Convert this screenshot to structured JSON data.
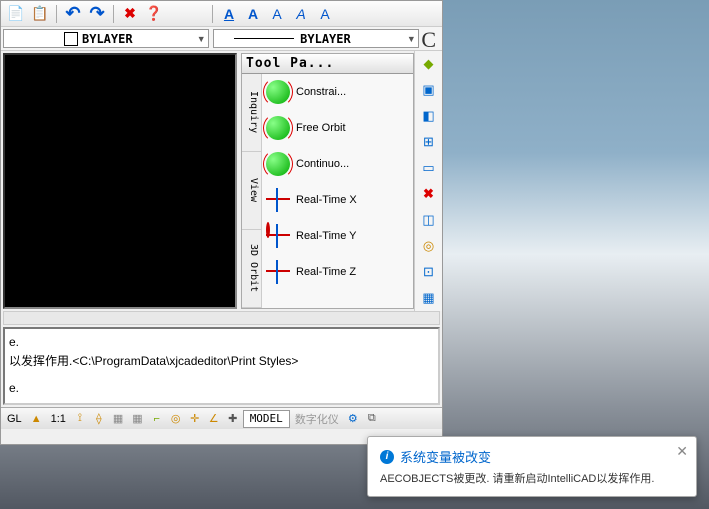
{
  "toolbar1": {
    "new": "📄",
    "copy": "📋",
    "undo": "↶",
    "redo": "↷",
    "delete": "✖",
    "help": "❓",
    "textA1": "A",
    "textA2": "A",
    "textA3": "A",
    "textA4": "A",
    "textA5": "A"
  },
  "layers": {
    "left_label": "BYLAYER",
    "right_label": "BYLAYER",
    "c_icon": "C"
  },
  "palette": {
    "title": "Tool Pa...",
    "tabs": [
      "Inquiry",
      "View",
      "3D Orbit"
    ],
    "items": [
      {
        "label": "Constrai...",
        "kind": "orb"
      },
      {
        "label": "Free Orbit",
        "kind": "orb"
      },
      {
        "label": "Continuo...",
        "kind": "orb"
      },
      {
        "label": "Real-Time X",
        "kind": "ring"
      },
      {
        "label": "Real-Time Y",
        "kind": "ring"
      },
      {
        "label": "Real-Time Z",
        "kind": "ring"
      }
    ]
  },
  "cmd": {
    "line1": "e.",
    "line2": "以发挥作用.<C:\\ProgramData\\xjcadeditor\\Print Styles>",
    "line3": "e."
  },
  "status": {
    "gl": "GL",
    "ratio": "1:1",
    "model": "MODEL",
    "digitizer": "数字化仪",
    "gear": "⚙"
  },
  "notif": {
    "title": "系统变量被改变",
    "body": "AECOBJECTS被更改. 请重新启动IntelliCAD以发挥作用.",
    "close": "✕",
    "info": "i"
  }
}
